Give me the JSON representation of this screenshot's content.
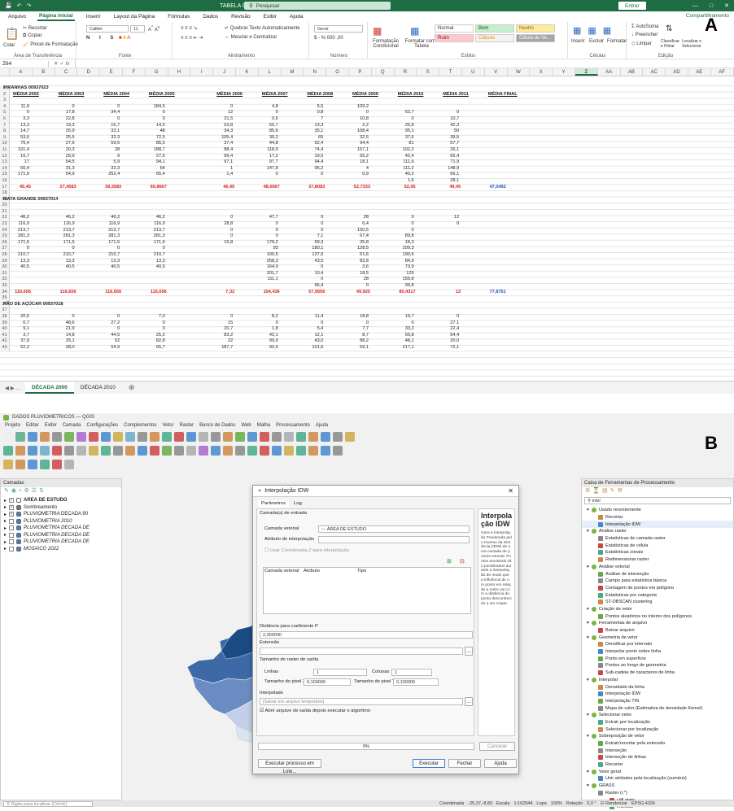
{
  "excel": {
    "title": "TABELA GERAL - Excel",
    "search": "Pesquisar",
    "enter_label": "Entrar",
    "share": "Compartilhamento",
    "tabs": [
      "Arquivo",
      "Página Inicial",
      "Inserir",
      "Layout da Página",
      "Fórmulas",
      "Dados",
      "Revisão",
      "Exibir",
      "Ajuda"
    ],
    "ribbon": {
      "paste": "Colar",
      "cut": "Recortar",
      "copy": "Copiar",
      "format_painter": "Pincel de Formatação",
      "clipboard": "Área de Transferência",
      "font_name": "Calibri",
      "font_size": "11",
      "font": "Fonte",
      "wrap": "Quebrar Texto Automaticamente",
      "merge": "Mesclar e Centralizar",
      "alignment": "Alinhamento",
      "number_format": "Geral",
      "number": "Número",
      "cond_format": "Formatação Condicional",
      "format_table": "Formatar como Tabela",
      "styles": "Estilos",
      "style_normal": "Normal",
      "style_bom": "Bom",
      "style_neutro": "Neutro",
      "style_ruim": "Ruim",
      "style_calculo": "Cálculo",
      "style_celula": "Célula de Ve...",
      "insert": "Inserir",
      "delete": "Excluir",
      "format": "Formatar",
      "cells": "Células",
      "autosum": "AutoSoma",
      "fill": "Preencher",
      "clear": "Limpar",
      "sort": "Classificar e Filtrar",
      "find": "Localizar e Selecionar",
      "editing": "Edição"
    },
    "name_box": "Z64",
    "fx": "fx",
    "columns": [
      "A",
      "B",
      "C",
      "D",
      "E",
      "F",
      "G",
      "H",
      "I",
      "J",
      "K",
      "L",
      "M",
      "N",
      "O",
      "P",
      "Q",
      "R",
      "S",
      "T",
      "U",
      "V",
      "W",
      "X",
      "Y",
      "Z",
      "AA",
      "AB",
      "AC",
      "AD",
      "AE",
      "AF"
    ],
    "selected_column": "Z",
    "section_1": "PIRANHAS 00937023",
    "section_2": "MATA GRANDE 00937014",
    "section_3": "PÃO DE AÇÚCAR 00937018",
    "headers": [
      "MÉDIA 2002",
      "MÉDIA 2003",
      "MÉDIA 2004",
      "MÉDIA 2005",
      "MÉDIA 2006",
      "MÉDIA 2007",
      "MÉDIA 2008",
      "MÉDIA 2009",
      "MÉDIA 2010",
      "MÉDIA 2011",
      "MÉDIA FINAL"
    ],
    "rows_a": [
      [
        "11,9",
        "0",
        "0",
        "184,5",
        "0",
        "4,8",
        "5,5",
        "109,2",
        "",
        "",
        ""
      ],
      [
        "0",
        "17,8",
        "34,4",
        "0",
        "12",
        "0",
        "0,8",
        "0",
        "52,7",
        "0",
        ""
      ],
      [
        "3,3",
        "22,8",
        "0",
        "0",
        "31,5",
        "0,6",
        "7",
        "10,8",
        "0",
        "10,7",
        ""
      ],
      [
        "13,3",
        "19,3",
        "16,7",
        "14,5",
        "53,8",
        "55,7",
        "13,3",
        "2,2",
        "20,8",
        "42,3",
        ""
      ],
      [
        "14,7",
        "25,9",
        "33,1",
        "48",
        "34,3",
        "85,6",
        "35,1",
        "108,4",
        "95,1",
        "50",
        ""
      ],
      [
        "53,5",
        "25,5",
        "32,3",
        "72,5",
        "105,4",
        "30,2",
        "65",
        "32,5",
        "37,6",
        "39,5",
        ""
      ],
      [
        "75,4",
        "27,6",
        "59,6",
        "85,5",
        "37,4",
        "44,8",
        "52,4",
        "94,4",
        "81",
        "57,7",
        ""
      ],
      [
        "101,4",
        "20,3",
        "28",
        "188,7",
        "88,4",
        "118,9",
        "74,4",
        "157,1",
        "102,2",
        "26,1",
        ""
      ],
      [
        "16,7",
        "29,9",
        "9",
        "27,5",
        "99,4",
        "17,2",
        "19,5",
        "55,2",
        "42,4",
        "65,4",
        ""
      ],
      [
        "17",
        "54,5",
        "5,9",
        "94,1",
        "97,1",
        "97,7",
        "94,4",
        "18,1",
        "111,6",
        "71,9",
        ""
      ],
      [
        "66,4",
        "31,3",
        "32,3",
        "64",
        "1",
        "147,8",
        "95,2",
        "4",
        "111,2",
        "148,9",
        ""
      ],
      [
        "171,9",
        "54,9",
        "252,4",
        "65,4",
        "1,4",
        "0",
        "0",
        "0,9",
        "40,2",
        "66,1",
        ""
      ],
      [
        "",
        "",
        "",
        "",
        "",
        "",
        "",
        "",
        "1,6",
        "28,1",
        ""
      ]
    ],
    "avg_a": [
      "45,45",
      "27,4583",
      "39,3583",
      "60,8667",
      "46,45",
      "48,6667",
      "37,8083",
      "52,7333",
      "52,95",
      "49,45",
      "47,0492"
    ],
    "rows_b": [
      [
        "46,2",
        "46,2",
        "46,2",
        "46,2",
        "0",
        "47,7",
        "0",
        "28",
        "0",
        "12",
        ""
      ],
      [
        "116,9",
        "116,9",
        "116,9",
        "116,9",
        "28,8",
        "0",
        "0",
        "6,4",
        "0",
        "0",
        ""
      ],
      [
        "213,7",
        "213,7",
        "213,7",
        "213,7",
        "0",
        "9",
        "0",
        "150,5",
        "0",
        "",
        ""
      ],
      [
        "281,3",
        "281,3",
        "281,3",
        "281,3",
        "0",
        "0",
        "7,1",
        "67,4",
        "89,8",
        "",
        ""
      ],
      [
        "171,5",
        "171,5",
        "171,5",
        "171,5",
        "15,8",
        "179,2",
        "99,3",
        "35,8",
        "18,3",
        "",
        ""
      ],
      [
        "0",
        "0",
        "0",
        "0",
        "",
        "93",
        "180,1",
        "128,5",
        "209,3",
        "",
        ""
      ],
      [
        "210,7",
        "210,7",
        "210,7",
        "210,7",
        "",
        "100,5",
        "137,5",
        "51,6",
        "190,6",
        "",
        ""
      ],
      [
        "13,3",
        "13,3",
        "13,3",
        "13,3",
        "",
        "258,3",
        "43,5",
        "83,8",
        "84,9",
        "",
        ""
      ],
      [
        "40,5",
        "40,5",
        "40,5",
        "40,5",
        "",
        "164,9",
        "0",
        "3,6",
        "73,9",
        "",
        ""
      ],
      [
        "",
        "",
        "",
        "",
        "",
        "201,7",
        "10,4",
        "18,5",
        "129",
        "",
        ""
      ],
      [
        "",
        "",
        "",
        "",
        "",
        "111,1",
        "0",
        "28",
        "159,8",
        "",
        ""
      ],
      [
        "",
        "",
        "",
        "",
        "",
        "",
        "96,4",
        "0",
        "99,8",
        "",
        ""
      ]
    ],
    "avg_b": [
      "116,656",
      "116,656",
      "116,656",
      "116,656",
      "7,32",
      "104,436",
      "57,9556",
      "49,925",
      "80,4317",
      "12",
      "77,8751"
    ],
    "rows_c": [
      [
        "20,5",
        "0",
        "0",
        "7,0",
        "0",
        "8,2",
        "11,4",
        "18,8",
        "19,7",
        "0",
        ""
      ],
      [
        "0,7",
        "48,6",
        "27,2",
        "0",
        "15",
        "0",
        "0",
        "0",
        "0",
        "27,1",
        ""
      ],
      [
        "9,1",
        "21,9",
        "0",
        "0",
        "20,7",
        "1,8",
        "5,4",
        "7,7",
        "33,2",
        "22,4",
        ""
      ],
      [
        "3,7",
        "14,8",
        "44,5",
        "25,2",
        "83,2",
        "42,1",
        "12,1",
        "8,7",
        "50,8",
        "54,4",
        ""
      ],
      [
        "37,9",
        "25,1",
        "52",
        "82,8",
        "22",
        "99,9",
        "43,0",
        "88,2",
        "48,1",
        "20,0",
        ""
      ],
      [
        "52,2",
        "28,0",
        "54,9",
        "65,7",
        "187,7",
        "92,6",
        "101,6",
        "59,1",
        "217,1",
        "72,1",
        ""
      ]
    ],
    "sheets": [
      "DÉCADA 2000",
      "DÉCADA 2010"
    ],
    "active_sheet": "DÉCADA 2000"
  },
  "qgis": {
    "title": "DADOS PLUVIOMETRICOS — QGIS",
    "menu": [
      "Projeto",
      "Editar",
      "Exibir",
      "Camada",
      "Configurações",
      "Complementos",
      "Vetor",
      "Raster",
      "Banco de Dados",
      "Web",
      "Malha",
      "Processamento",
      "Ajuda"
    ],
    "layers_panel": "Camadas",
    "layers": [
      {
        "name": "AREA DE ESTUDO",
        "checked": true,
        "italic": false
      },
      {
        "name": "Sombreamento",
        "checked": true,
        "italic": false
      },
      {
        "name": "PLUVIOMETRIA DECADA 90",
        "checked": true,
        "italic": false
      },
      {
        "name": "PLUVIOMETRIA 2010",
        "checked": false,
        "italic": true
      },
      {
        "name": "PLUVIOMETRIA DECADA DE",
        "checked": false,
        "italic": true
      },
      {
        "name": "PLUVIOMETRIA DECADA DE",
        "checked": false,
        "italic": true
      },
      {
        "name": "PLUVIOMETRIA DECADA DE",
        "checked": false,
        "italic": true
      },
      {
        "name": "MOSAICO 2022",
        "checked": false,
        "italic": true
      }
    ],
    "toolbox_title": "Caixa de Ferramentas de Processamento",
    "toolbox_search": "inter",
    "toolbox": [
      {
        "t": "Usado recentemente",
        "lvl": 0,
        "g": true
      },
      {
        "t": "Recortar",
        "lvl": 1
      },
      {
        "t": "Interpolação IDW",
        "lvl": 1,
        "sel": true
      },
      {
        "t": "Análise raster",
        "lvl": 0,
        "g": true
      },
      {
        "t": "Estatísticas de camada raster",
        "lvl": 1
      },
      {
        "t": "Estatísticas de célula",
        "lvl": 1
      },
      {
        "t": "Estatísticas zonais",
        "lvl": 1
      },
      {
        "t": "Redimensionar raster",
        "lvl": 1
      },
      {
        "t": "Análise vetorial",
        "lvl": 0,
        "g": true
      },
      {
        "t": "Análise de interseção",
        "lvl": 1
      },
      {
        "t": "Campo para estatística básica",
        "lvl": 1
      },
      {
        "t": "Contagem de pontos em polígono",
        "lvl": 1
      },
      {
        "t": "Estatísticas por categoria",
        "lvl": 1
      },
      {
        "t": "ST-DBSCAN clustering",
        "lvl": 1
      },
      {
        "t": "Criação de vetor",
        "lvl": 0,
        "g": true
      },
      {
        "t": "Pontos aleatórios no interior dos polígonos",
        "lvl": 1
      },
      {
        "t": "Ferramentas de arquivo",
        "lvl": 0,
        "g": true
      },
      {
        "t": "Baixar arquivo",
        "lvl": 1
      },
      {
        "t": "Geometria de vetor",
        "lvl": 0,
        "g": true
      },
      {
        "t": "Densificar por intervalo",
        "lvl": 1
      },
      {
        "t": "Interpolar ponto sobre linha",
        "lvl": 1
      },
      {
        "t": "Ponto em superfície",
        "lvl": 1
      },
      {
        "t": "Pontos ao longo de geometria",
        "lvl": 1
      },
      {
        "t": "Sub-cadeia de caracteres de linha",
        "lvl": 1
      },
      {
        "t": "Interpolar",
        "lvl": 0,
        "g": true
      },
      {
        "t": "Densidade da linha",
        "lvl": 1
      },
      {
        "t": "Interpolação IDW",
        "lvl": 1
      },
      {
        "t": "Interpolação TIN",
        "lvl": 1
      },
      {
        "t": "Mapa de calor (Estimativa de densidade Kernel)",
        "lvl": 1
      },
      {
        "t": "Selecionar vetor",
        "lvl": 0,
        "g": true
      },
      {
        "t": "Extrair por localização",
        "lvl": 1
      },
      {
        "t": "Selecionar por localização",
        "lvl": 1
      },
      {
        "t": "Sobreposição de vetor",
        "lvl": 0,
        "g": true
      },
      {
        "t": "Extrair/recortar pela extensão",
        "lvl": 1
      },
      {
        "t": "Interseção",
        "lvl": 1
      },
      {
        "t": "Interseção de linhas",
        "lvl": 1
      },
      {
        "t": "Recortar",
        "lvl": 1
      },
      {
        "t": "Vetor geral",
        "lvl": 0,
        "g": true
      },
      {
        "t": "Unir atributos pela localização (sumário)",
        "lvl": 1
      },
      {
        "t": "GRASS",
        "lvl": 0,
        "g": true
      },
      {
        "t": "Raster (r.*)",
        "lvl": 1
      },
      {
        "t": "r.fill.stats",
        "lvl": 2
      },
      {
        "t": "r.fillnulls",
        "lvl": 2
      }
    ],
    "dialog": {
      "title": "Interpolação IDW",
      "tab_params": "Parâmetros",
      "tab_log": "Log",
      "input_layers": "Camada(s) de entrada",
      "vector_layer": "Camada vetorial",
      "vector_value": "ÁREA DE ESTUDO",
      "attr": "Atributo de interpolação",
      "use_z": "Usar Coordenada Z para interpolação",
      "col_layer": "Camada vetorial",
      "col_attr": "Atributo",
      "col_type": "Tipo",
      "distance": "Distância para coeficiente P",
      "distance_value": "2,000000",
      "extent": "Extensão",
      "raster_size": "Tamanho do raster de saída",
      "rows": "Linhas",
      "rows_value": "1",
      "cols": "Colunas",
      "cols_value": "1",
      "pixel_x": "Tamanho do pixel X",
      "pixel_x_value": "0,100000",
      "pixel_y": "Tamanho do pixel Y",
      "pixel_y_value": "0,100000",
      "interpolated": "Interpolado",
      "save_placeholder": "[Salvar em arquivo temporário]",
      "open_after": "Abrir arquivo de saída depois executar o algoritmo",
      "progress": "0%",
      "cancel": "Cancelar",
      "batch": "Executar processo em Lote...",
      "run": "Executar",
      "close": "Fechar",
      "help": "Ajuda",
      "help_title": "Interpolação IDW",
      "help_text": "Gera a interpolação Ponderada pelo Inverso da Distância (IDW) de uma camada de pontos vetorial. Pontos amostrais são ponderados durante a interpolação de modo que a influência de um ponto em relação a outro cai com a distância do ponto desconhecido a ser criado."
    },
    "status": {
      "locate": "Digite para localizar (Ctrl+K)",
      "coord_label": "Coordenada",
      "coord": "-25,37,-8,83",
      "scale_label": "Escala",
      "scale": "1:102944",
      "zoom_label": "Lupa",
      "zoom": "100%",
      "rot_label": "Rotação",
      "rot": "0,0 °",
      "render": "Renderizar",
      "epsg": "EPSG:4326"
    }
  },
  "labels": {
    "a": "A",
    "b": "B"
  },
  "colors": {
    "excel_green": "#1e6c41",
    "avg_red": "#e02020",
    "map_dark": "#1b4b83",
    "map_light": "#dbe4f0"
  }
}
